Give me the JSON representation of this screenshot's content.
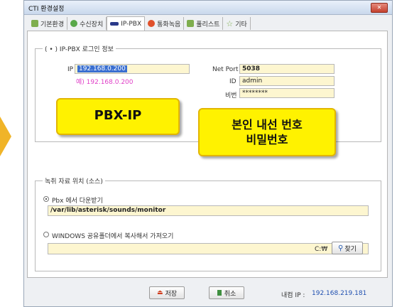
{
  "window": {
    "title": "CTI 환경설정",
    "close_label": "✕"
  },
  "tabs": [
    {
      "label": "기본환경",
      "color": "#7fae4e"
    },
    {
      "label": "수신장치",
      "color": "#59a84a"
    },
    {
      "label": "IP-PBX",
      "color": "#2b3a8a"
    },
    {
      "label": "통화녹음",
      "color": "#e0502a"
    },
    {
      "label": "풀리스트",
      "color": "#7fae4e"
    },
    {
      "label": "기타",
      "color": "#c9a91f"
    }
  ],
  "pbx_login": {
    "legend": "( • ) IP-PBX 로그인 정보",
    "ip_label": "IP",
    "ip_value": "192.168.0.200",
    "ip_example": "예) 192.168.0.200",
    "netport_label": "Net Port",
    "netport_value": "5038",
    "id_label": "ID",
    "id_value": "admin",
    "pw_label": "비번",
    "pw_value": "********"
  },
  "callouts": {
    "pbx_ip": "PBX-IP",
    "ext_line1": "본인 내선 번호",
    "ext_line2": "비밀번호"
  },
  "record_location": {
    "legend": "녹취 자료 위치 (소스)",
    "option1_label": "Pbx 에서 다운받기",
    "option1_path": "/var/lib/asterisk/sounds/monitor",
    "option2_label": "WINDOWS 공유폴더에서 복사해서 가져오기",
    "option2_path": "",
    "drive_label": "C:₩",
    "find_button": "찾기"
  },
  "footer": {
    "save_label": "저장",
    "cancel_label": "취소",
    "internal_ip_label": "내컴 IP :",
    "internal_ip_value": "192.168.219.181"
  },
  "colors": {
    "callout_fill": "#fff200",
    "field_fill": "#fdf6d0",
    "example_text": "#e040c8",
    "accent_ip": "#2050b0"
  }
}
